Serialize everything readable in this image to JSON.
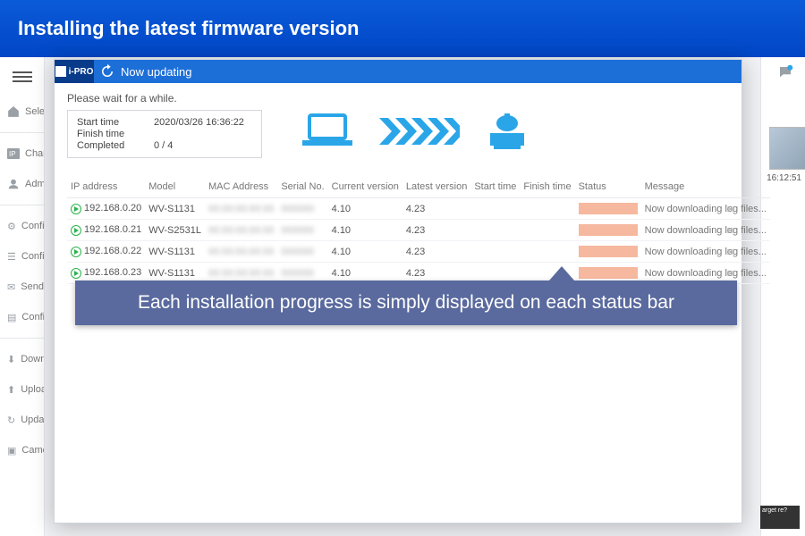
{
  "banner_title": "Installing the latest firmware version",
  "sidebar": {
    "items": [
      {
        "label": "Select"
      },
      {
        "label": "Chan"
      },
      {
        "label": "Admi"
      },
      {
        "label": "Confi"
      },
      {
        "label": "Confi"
      },
      {
        "label": "Send"
      },
      {
        "label": "Confi"
      },
      {
        "label": "Down"
      },
      {
        "label": "Uploa"
      },
      {
        "label": "Upda"
      },
      {
        "label": "Came"
      }
    ]
  },
  "dialog": {
    "app_label": "i-PRO",
    "title": "Now updating",
    "wait_text": "Please wait for a while.",
    "status": {
      "start_label": "Start time",
      "start_value": "2020/03/26 16:36:22",
      "finish_label": "Finish time",
      "finish_value": "",
      "completed_label": "Completed",
      "completed_value": "0 / 4"
    },
    "columns": [
      "IP address",
      "Model",
      "MAC Address",
      "Serial No.",
      "Current version",
      "Latest version",
      "Start time",
      "Finish time",
      "Status",
      "Message"
    ],
    "rows": [
      {
        "ip": "192.168.0.20",
        "model": "WV-S1131",
        "mac": "",
        "serial": "",
        "curr": "4.10",
        "latest": "4.23",
        "start": "",
        "finish": "",
        "msg": "Now downloading log files..."
      },
      {
        "ip": "192.168.0.21",
        "model": "WV-S2531L",
        "mac": "",
        "serial": "",
        "curr": "4.10",
        "latest": "4.23",
        "start": "",
        "finish": "",
        "msg": "Now downloading log files..."
      },
      {
        "ip": "192.168.0.22",
        "model": "WV-S1131",
        "mac": "",
        "serial": "",
        "curr": "4.10",
        "latest": "4.23",
        "start": "",
        "finish": "",
        "msg": "Now downloading log files..."
      },
      {
        "ip": "192.168.0.23",
        "model": "WV-S1131",
        "mac": "",
        "serial": "",
        "curr": "4.10",
        "latest": "4.23",
        "start": "",
        "finish": "",
        "msg": "Now downloading log files..."
      }
    ]
  },
  "callout_text": "Each installation progress is simply displayed on each status bar",
  "right": {
    "thumb_time": "16:12:51",
    "confirm_text": "arget\nre?"
  }
}
